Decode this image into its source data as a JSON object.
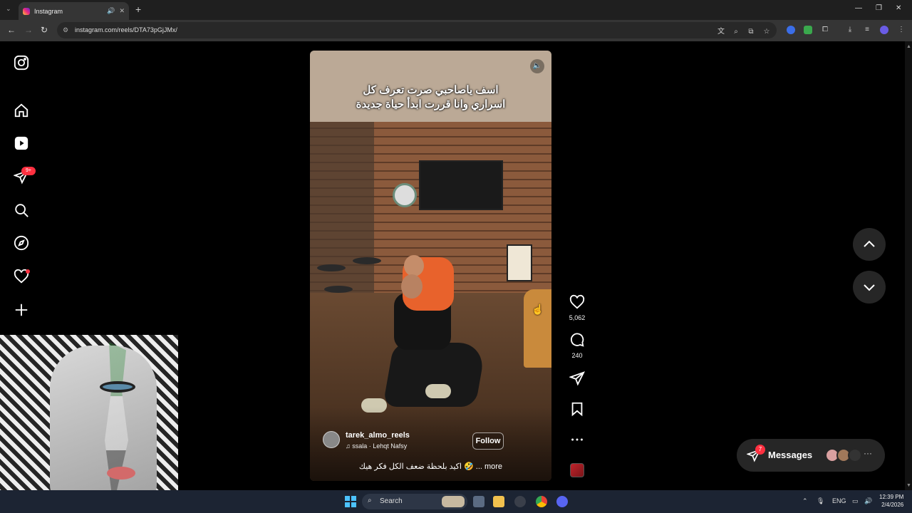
{
  "browser": {
    "tab_title": "Instagram",
    "new_tab": "+",
    "url": "instagram.com/reels/DTA73pGjJMx/"
  },
  "sidebar": {
    "notifications_badge": "9+"
  },
  "reel": {
    "overlay_text_line1": "اسف ياصاحبي صرت تعرف كل",
    "overlay_text_line2": "اسراري وانا قررت ابدأ حياة جديدة",
    "author": "tarek_almo_reels",
    "audio": "ssala · Lehqt Nafsy",
    "follow_label": "Follow",
    "caption": "اكيد بلحظة ضعف الكل فكر هيك 🤣 ... more"
  },
  "actions": {
    "likes": "5,062",
    "comments": "240"
  },
  "messages": {
    "label": "Messages",
    "badge": "7"
  },
  "taskbar": {
    "search_label": "Search",
    "language": "ENG",
    "time": "12:39 PM",
    "date": "2/4/2026"
  },
  "colors": {
    "accent_red": "#ff3040",
    "background": "#000000",
    "panel": "#262626"
  }
}
